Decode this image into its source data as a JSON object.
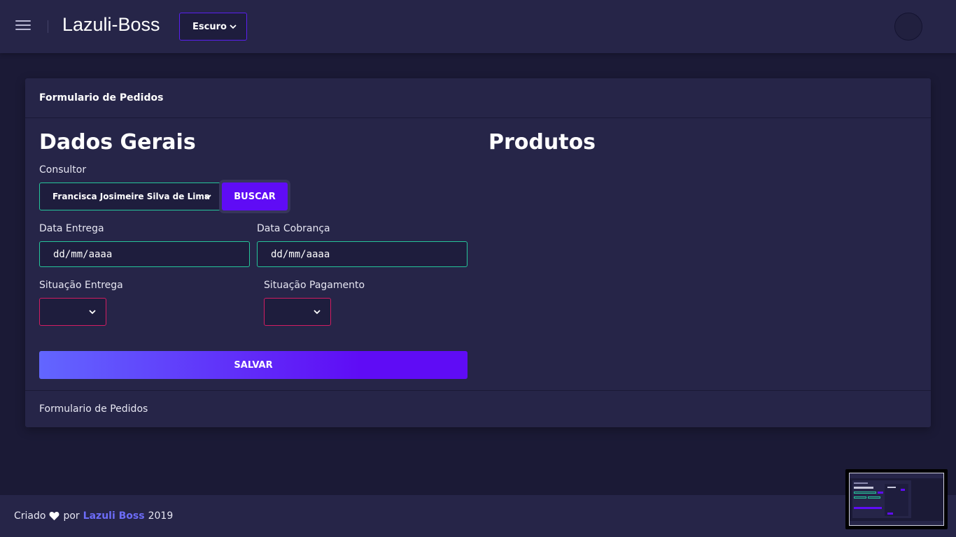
{
  "header": {
    "app_title": "Lazuli-Boss",
    "theme_select": "Escuro"
  },
  "card": {
    "header_title": "Formulario de Pedidos",
    "footer_text": "Formulario de Pedidos"
  },
  "form": {
    "section_title": "Dados Gerais",
    "consultor_label": "Consultor",
    "consultor_value": "Francisca Josimeire Silva de Lima",
    "buscar_label": "BUSCAR",
    "data_entrega_label": "Data Entrega",
    "data_entrega_value": "dd/mm/aaaa",
    "data_cobranca_label": "Data Cobrança",
    "data_cobranca_value": "dd/mm/aaaa",
    "situacao_entrega_label": "Situação Entrega",
    "situacao_pagamento_label": "Situação Pagamento",
    "salvar_label": "SALVAR"
  },
  "produtos": {
    "section_title": "Produtos"
  },
  "footer": {
    "prefix": "Criado",
    "por": "por",
    "brand": "Lazuli Boss",
    "year": "2019"
  },
  "colors": {
    "accent": "#5f0cf5",
    "input_border": "#25c59a",
    "select_border": "#d21d62",
    "link": "#6c6cf7"
  },
  "icons": {
    "menu": "hamburger-icon",
    "chevron": "chevron-down-icon",
    "heart": "heart-icon"
  }
}
